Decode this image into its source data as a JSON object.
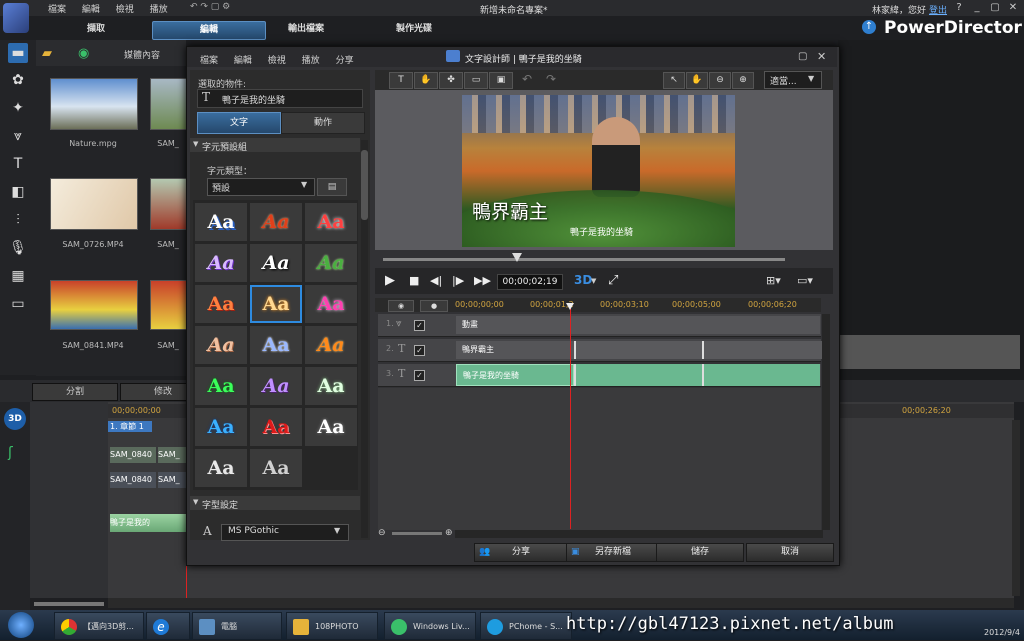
{
  "main_window": {
    "menu": [
      "檔案",
      "編輯",
      "檢視",
      "播放"
    ],
    "title": "新增未命名專案*",
    "user": "林家緯，您好",
    "logout": "登出",
    "brand": "PowerDirector",
    "tabs": [
      "擷取",
      "編輯",
      "輸出檔案",
      "製作光碟"
    ],
    "media_room_label": "媒體內容",
    "split_button": "分割",
    "modify_button": "修改",
    "timecode_start": "00;00;00;00",
    "timecode_end": "00;00;26;20",
    "chapter_label": "1. 章節 1",
    "track1_clips": [
      "SAM_0840",
      "SAM_",
      "SAM_0840",
      "SAM_"
    ],
    "track2_clip": "鴨子是我的"
  },
  "media": [
    {
      "name": "Nature.mpg"
    },
    {
      "name": "SAM_"
    },
    {
      "name": "SAM_0726.MP4"
    },
    {
      "name": "SAM_"
    },
    {
      "name": "SAM_0841.MP4"
    },
    {
      "name": "SAM_"
    }
  ],
  "dialog": {
    "menu": [
      "檔案",
      "編輯",
      "檢視",
      "播放",
      "分享"
    ],
    "title": "文字設計師 | 鴨子是我的坐騎",
    "selected_object_label": "選取的物件:",
    "selected_object_value": "鴨子是我的坐騎",
    "tab_text": "文字",
    "tab_motion": "動作",
    "preset_group": "字元預設組",
    "char_type_label": "字元類型：",
    "char_type_value": "預設",
    "font_settings": "字型設定",
    "font_value": "MS PGothic",
    "aa_label": "Aa",
    "zoom_select": "適當...",
    "preview_title": "鴨界霸主",
    "preview_subtitle": "鴨子是我的坐騎",
    "timecode": "00;00;02;19",
    "mode_3d": "3D",
    "ruler": [
      "00;00;00;00",
      "00;00;01;2",
      "00;00;03;10",
      "00;00;05;00",
      "00;00;06;20"
    ],
    "tracks": [
      {
        "num": "1.",
        "label": "動畫"
      },
      {
        "num": "2.",
        "label": "鴨界霸主"
      },
      {
        "num": "3.",
        "label": "鴨子是我的坐騎"
      }
    ],
    "buttons": {
      "share": "分享",
      "save_new": "另存新檔",
      "save": "儲存",
      "cancel": "取消"
    }
  },
  "taskbar": {
    "items": [
      "【邁向3D剪...",
      "",
      "電腦",
      "108PHOTO",
      "Windows Liv...",
      "PChome - S..."
    ],
    "date": "2012/9/4"
  },
  "watermark": "http://gbl47123.pixnet.net/album"
}
